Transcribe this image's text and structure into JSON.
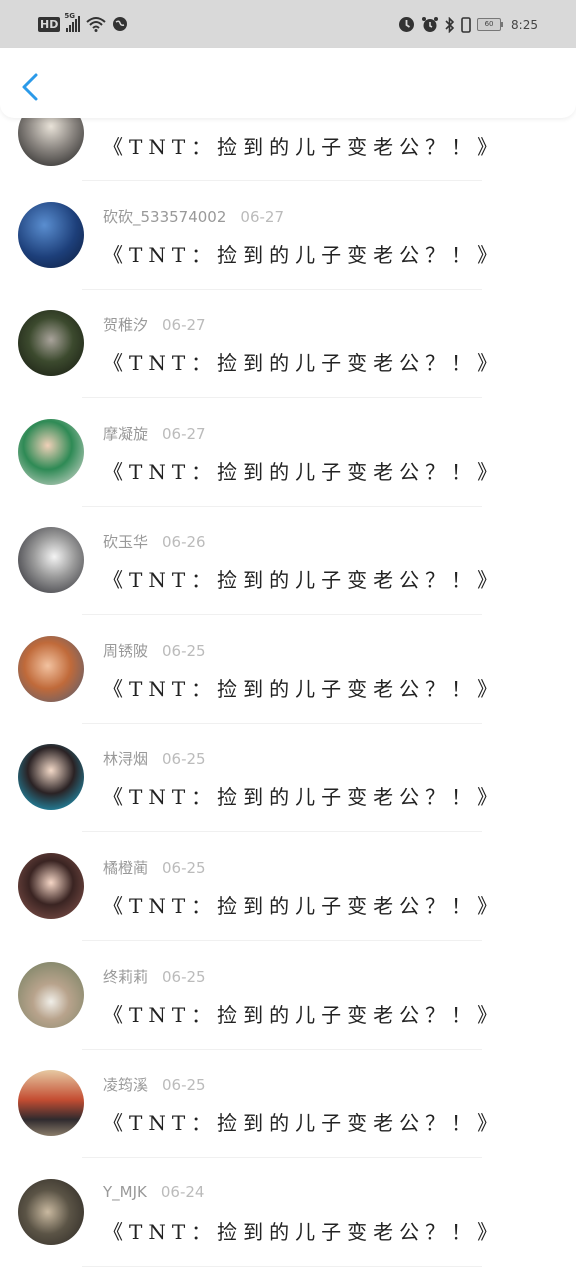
{
  "status_bar": {
    "hd": "HD",
    "network": "5G",
    "battery": "60",
    "time": "8:25"
  },
  "header": {
    "back_icon": "chevron-left-icon",
    "accent": "#2b9ae9"
  },
  "messages": [
    {
      "name": "",
      "date": "",
      "text": "《TNT：捡到的儿子变老公？！》"
    },
    {
      "name": "砍砍_533574002",
      "date": "06-27",
      "text": "《TNT：捡到的儿子变老公？！》"
    },
    {
      "name": "贺稚汐",
      "date": "06-27",
      "text": "《TNT：捡到的儿子变老公？！》"
    },
    {
      "name": "摩凝旋",
      "date": "06-27",
      "text": "《TNT：捡到的儿子变老公？！》"
    },
    {
      "name": "砍玉华",
      "date": "06-26",
      "text": "《TNT：捡到的儿子变老公？！》"
    },
    {
      "name": "周锈陂",
      "date": "06-25",
      "text": "《TNT：捡到的儿子变老公？！》"
    },
    {
      "name": "林浔烟",
      "date": "06-25",
      "text": "《TNT：捡到的儿子变老公？！》"
    },
    {
      "name": "橘橙蔺",
      "date": "06-25",
      "text": "《TNT：捡到的儿子变老公？！》"
    },
    {
      "name": "终莉莉",
      "date": "06-25",
      "text": "《TNT：捡到的儿子变老公？！》"
    },
    {
      "name": "凌筠溪",
      "date": "06-25",
      "text": "《TNT：捡到的儿子变老公？！》"
    },
    {
      "name": "Y_MJK",
      "date": "06-24",
      "text": "《TNT：捡到的儿子变老公？！》"
    }
  ]
}
